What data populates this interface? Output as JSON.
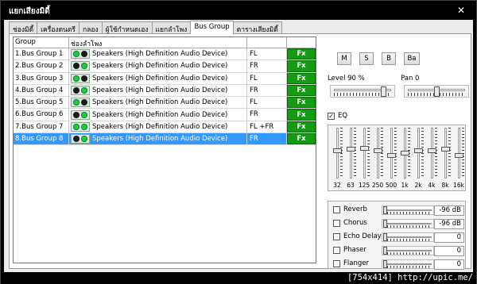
{
  "window": {
    "title": "แยกเสียงมิดี้",
    "close": "✕"
  },
  "tabs": [
    {
      "label": "ช่องมิดี้",
      "active": false
    },
    {
      "label": "เครื่องดนตรี",
      "active": false
    },
    {
      "label": "กลอง",
      "active": false
    },
    {
      "label": "ผู้ใช้กำหนดเอง",
      "active": false
    },
    {
      "label": "แยกลำโพง",
      "active": false
    },
    {
      "label": "Bus Group",
      "active": true
    },
    {
      "label": "ตารางเสียงมิดี้",
      "active": false
    }
  ],
  "grid": {
    "headers": {
      "group": "Group",
      "device": "ช่องลำโพง",
      "channel": "",
      "fx": ""
    },
    "rows": [
      {
        "group": "1.Bus Group 1",
        "dots": [
          "green",
          "black"
        ],
        "device": "Speakers (High Definition Audio Device)",
        "channel": "FL",
        "fx": "Fx"
      },
      {
        "group": "2.Bus Group 2",
        "dots": [
          "black",
          "green"
        ],
        "device": "Speakers (High Definition Audio Device)",
        "channel": "FR",
        "fx": "Fx"
      },
      {
        "group": "3.Bus Group 3",
        "dots": [
          "green",
          "black"
        ],
        "device": "Speakers (High Definition Audio Device)",
        "channel": "FL",
        "fx": "Fx"
      },
      {
        "group": "4.Bus Group 4",
        "dots": [
          "black",
          "green"
        ],
        "device": "Speakers (High Definition Audio Device)",
        "channel": "FR",
        "fx": "Fx"
      },
      {
        "group": "5.Bus Group 5",
        "dots": [
          "green",
          "black"
        ],
        "device": "Speakers (High Definition Audio Device)",
        "channel": "FL",
        "fx": "Fx"
      },
      {
        "group": "6.Bus Group 6",
        "dots": [
          "black",
          "green"
        ],
        "device": "Speakers (High Definition Audio Device)",
        "channel": "FR",
        "fx": "Fx"
      },
      {
        "group": "7.Bus Group 7",
        "dots": [
          "green",
          "green"
        ],
        "device": "Speakers (High Definition Audio Device)",
        "channel": "FL +FR",
        "fx": "Fx"
      },
      {
        "group": "8.Bus Group 8",
        "dots": [
          "black",
          "green"
        ],
        "device": "Speakers (High Definition Audio Device)",
        "channel": "FR",
        "fx": "Fx",
        "selected": true
      }
    ]
  },
  "controls": {
    "buttons": [
      "M",
      "S",
      "B",
      "Ba"
    ],
    "level_label": "Level 90 %",
    "level_value": 0.9,
    "pan_label": "Pan 0",
    "pan_value": 0.5,
    "eq_label": "EQ",
    "eq_checked": true,
    "eq_check_glyph": "✓",
    "eq_bands": [
      {
        "freq": "32",
        "level": 0.55
      },
      {
        "freq": "63",
        "level": 0.58
      },
      {
        "freq": "125",
        "level": 0.6
      },
      {
        "freq": "250",
        "level": 0.55
      },
      {
        "freq": "500",
        "level": 0.45
      },
      {
        "freq": "1k",
        "level": 0.5
      },
      {
        "freq": "2k",
        "level": 0.55
      },
      {
        "freq": "4k",
        "level": 0.55
      },
      {
        "freq": "8k",
        "level": 0.58
      },
      {
        "freq": "16k",
        "level": 0.45
      }
    ],
    "effects": [
      {
        "name": "Reverb",
        "value": "-96 dB",
        "checked": false
      },
      {
        "name": "Chorus",
        "value": "-96 dB",
        "checked": false
      },
      {
        "name": "Echo Delay",
        "value": "0",
        "checked": false
      },
      {
        "name": "Phaser",
        "value": "0",
        "checked": false
      },
      {
        "name": "Flanger",
        "value": "0",
        "checked": false
      }
    ]
  },
  "watermark": "[754x414] http://upic.me/",
  "colors": {
    "selection": "#3399ff",
    "fx_green": "#129c12",
    "led_green": "#2ec82e"
  }
}
